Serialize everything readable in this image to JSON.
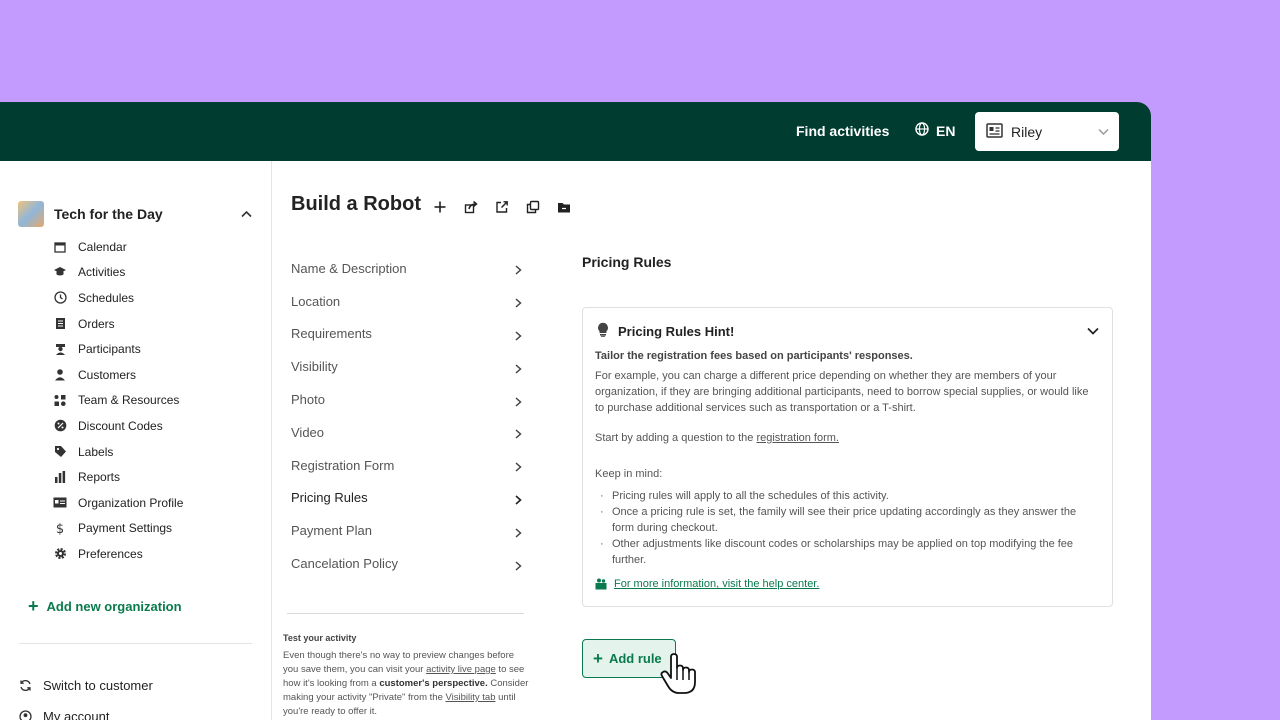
{
  "header": {
    "find_activities": "Find activities",
    "language": "EN",
    "user_name": "Riley",
    "bg_color": "#003d30"
  },
  "sidebar": {
    "organization": "Tech for the Day",
    "items": [
      {
        "label": "Calendar",
        "icon": "calendar-icon"
      },
      {
        "label": "Activities",
        "icon": "graduation-cap-icon"
      },
      {
        "label": "Schedules",
        "icon": "clock-icon"
      },
      {
        "label": "Orders",
        "icon": "receipt-icon"
      },
      {
        "label": "Participants",
        "icon": "participant-icon"
      },
      {
        "label": "Customers",
        "icon": "person-icon"
      },
      {
        "label": "Team & Resources",
        "icon": "team-resources-icon"
      },
      {
        "label": "Discount Codes",
        "icon": "discount-icon"
      },
      {
        "label": "Labels",
        "icon": "tag-icon"
      },
      {
        "label": "Reports",
        "icon": "bar-chart-icon"
      },
      {
        "label": "Organization Profile",
        "icon": "id-card-icon"
      },
      {
        "label": "Payment Settings",
        "icon": "dollar-icon"
      },
      {
        "label": "Preferences",
        "icon": "gear-icon"
      }
    ],
    "add_org": "Add new organization",
    "switch_customer": "Switch to customer",
    "my_account": "My account"
  },
  "page": {
    "title": "Build a Robot",
    "sections": [
      "Name & Description",
      "Location",
      "Requirements",
      "Visibility",
      "Photo",
      "Video",
      "Registration Form",
      "Pricing Rules",
      "Payment Plan",
      "Cancelation Policy"
    ],
    "active_section": "Pricing Rules",
    "test": {
      "title": "Test your activity",
      "p1": "Even though there's no way to preview changes before you save them, you can visit your ",
      "link1": "activity live page",
      "p2": " to see how it's looking from a ",
      "bold": "customer's perspective.",
      "p3": " Consider making your activity \"Private\" from the ",
      "link2": "Visibility tab",
      "p4": " until you're ready to offer it."
    }
  },
  "content": {
    "title": "Pricing Rules",
    "hint": {
      "title": "Pricing Rules Hint!",
      "subtitle": "Tailor the registration fees based on participants' responses.",
      "paragraph": "For example, you can charge a different price depending on whether they are members of your organization, if they are bringing additional participants, need to borrow special supplies, or would like to purchase additional services such as transportation or a T-shirt.",
      "start_prefix": "Start by adding a question to the ",
      "start_link": "registration form.",
      "keep_in_mind": "Keep in mind:",
      "bullets": [
        "Pricing rules will apply to all the schedules of this activity.",
        "Once a pricing rule is set, the family will see their price updating accordingly as they answer the form during checkout.",
        "Other adjustments like discount codes or scholarships may be applied on top modifying the fee further."
      ],
      "help_link": "For more information, visit the help center."
    },
    "add_rule": "Add rule"
  },
  "colors": {
    "accent": "#0a7a4e",
    "background": "#c39bff"
  }
}
